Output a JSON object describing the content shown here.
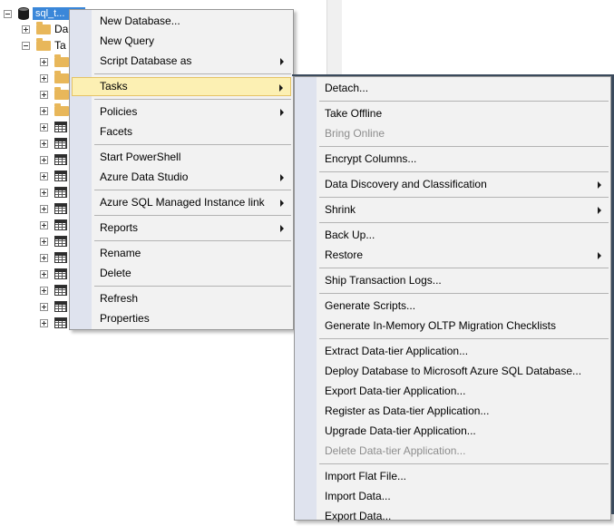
{
  "tree": {
    "selected_db_label": "sql_t...",
    "nodes": [
      {
        "label": "Da"
      },
      {
        "label": "Ta"
      }
    ]
  },
  "context_menu": {
    "items": [
      {
        "label": "New Database...",
        "submenu": false
      },
      {
        "label": "New Query",
        "submenu": false
      },
      {
        "label": "Script Database as",
        "submenu": true
      },
      {
        "label": "Tasks",
        "submenu": true,
        "highlighted": true
      },
      {
        "label": "Policies",
        "submenu": true
      },
      {
        "label": "Facets",
        "submenu": false
      },
      {
        "label": "Start PowerShell",
        "submenu": false
      },
      {
        "label": "Azure Data Studio",
        "submenu": true
      },
      {
        "label": "Azure SQL Managed Instance link",
        "submenu": true
      },
      {
        "label": "Reports",
        "submenu": true
      },
      {
        "label": "Rename",
        "submenu": false
      },
      {
        "label": "Delete",
        "submenu": false
      },
      {
        "label": "Refresh",
        "submenu": false
      },
      {
        "label": "Properties",
        "submenu": false
      }
    ]
  },
  "tasks_menu": {
    "items": [
      {
        "label": "Detach...",
        "submenu": false
      },
      {
        "label": "Take Offline",
        "submenu": false
      },
      {
        "label": "Bring Online",
        "submenu": false,
        "disabled": true
      },
      {
        "label": "Encrypt Columns...",
        "submenu": false
      },
      {
        "label": "Data Discovery and Classification",
        "submenu": true
      },
      {
        "label": "Shrink",
        "submenu": true
      },
      {
        "label": "Back Up...",
        "submenu": false
      },
      {
        "label": "Restore",
        "submenu": true
      },
      {
        "label": "Ship Transaction Logs...",
        "submenu": false
      },
      {
        "label": "Generate Scripts...",
        "submenu": false
      },
      {
        "label": "Generate In-Memory OLTP Migration Checklists",
        "submenu": false
      },
      {
        "label": "Extract Data-tier Application...",
        "submenu": false
      },
      {
        "label": "Deploy Database to Microsoft Azure SQL Database...",
        "submenu": false
      },
      {
        "label": "Export Data-tier Application...",
        "submenu": false
      },
      {
        "label": "Register as Data-tier Application...",
        "submenu": false
      },
      {
        "label": "Upgrade Data-tier Application...",
        "submenu": false
      },
      {
        "label": "Delete Data-tier Application...",
        "submenu": false,
        "disabled": true
      },
      {
        "label": "Import Flat File...",
        "submenu": false
      },
      {
        "label": "Import Data...",
        "submenu": false
      },
      {
        "label": "Export Data...",
        "submenu": false
      }
    ]
  },
  "colors": {
    "menu_background": "#f2f2f2",
    "menu_gutter": "#dfe3ee",
    "highlight_fill": "#fcf0b3",
    "highlight_border": "#e5c365",
    "selection_blue": "#3a87d9",
    "disabled_text": "#8d8d8d"
  }
}
